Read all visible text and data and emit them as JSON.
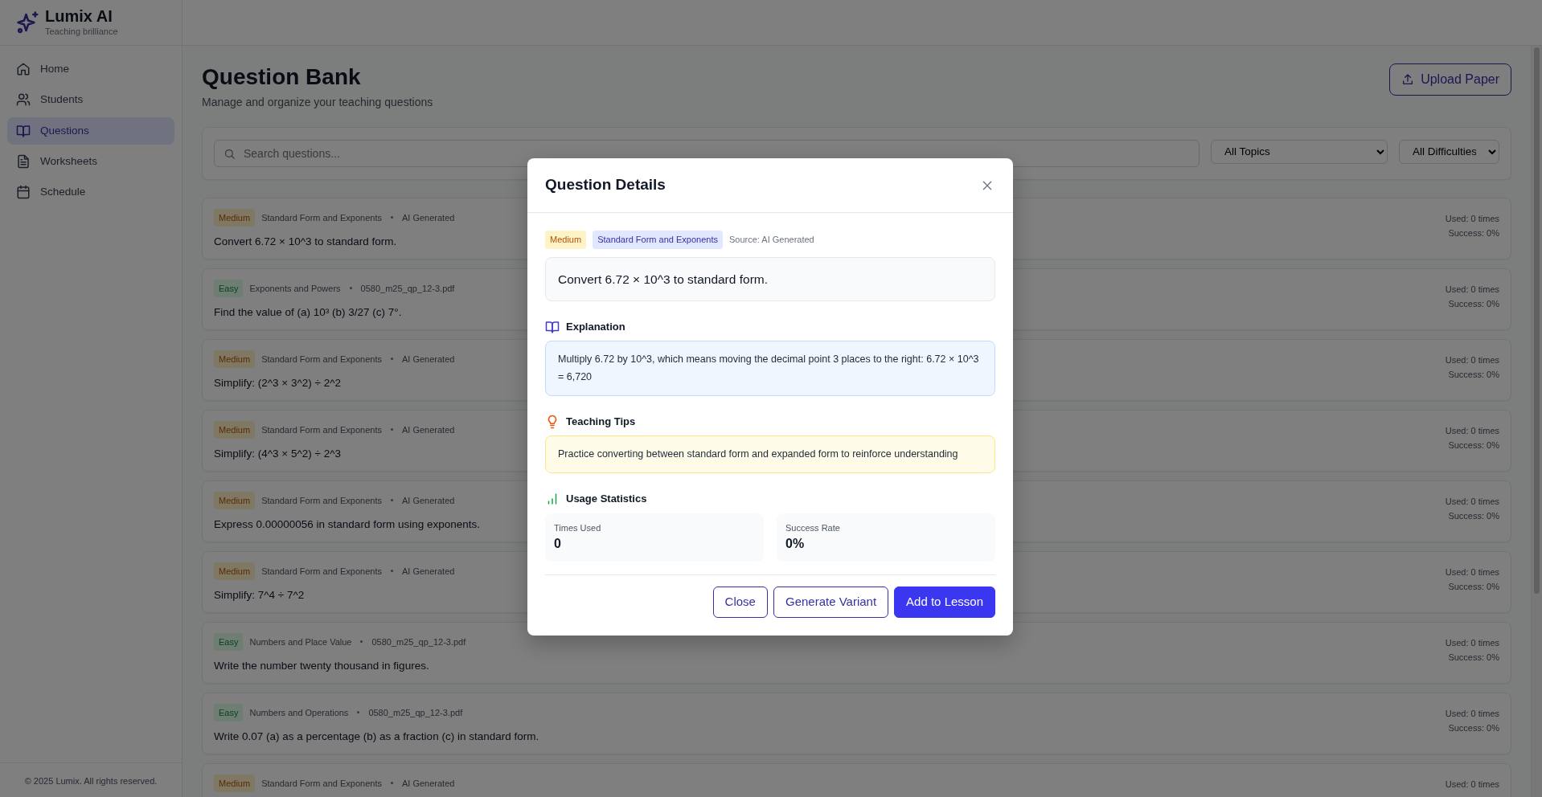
{
  "brand": {
    "name": "Lumix AI",
    "tagline": "Teaching brilliance"
  },
  "sidebar": {
    "items": [
      {
        "label": "Home",
        "selected": false
      },
      {
        "label": "Students",
        "selected": false
      },
      {
        "label": "Questions",
        "selected": true
      },
      {
        "label": "Worksheets",
        "selected": false
      },
      {
        "label": "Schedule",
        "selected": false
      }
    ],
    "footer": "© 2025 Lumix. All rights reserved."
  },
  "page": {
    "title": "Question Bank",
    "subtitle": "Manage and organize your teaching questions",
    "upload_button": "Upload Paper"
  },
  "filters": {
    "search": {
      "placeholder": "Search questions..."
    },
    "topic": "All Topics",
    "difficulty": "All Difficulties"
  },
  "questions": [
    {
      "difficulty": "Medium",
      "kind": "medium",
      "topic": "Standard Form and Exponents",
      "source": "AI Generated",
      "text": "Convert 6.72 × 10^3 to standard form.",
      "used": "Used: 0 times",
      "success": "Success: 0%"
    },
    {
      "difficulty": "Easy",
      "kind": "easy",
      "topic": "Exponents and Powers",
      "source": "0580_m25_qp_12-3.pdf",
      "text": "Find the value of (a) 10³ (b) 3/27 (c) 7°.",
      "used": "Used: 0 times",
      "success": "Success: 0%"
    },
    {
      "difficulty": "Medium",
      "kind": "medium",
      "topic": "Standard Form and Exponents",
      "source": "AI Generated",
      "text": "Simplify: (2^3 × 3^2) ÷ 2^2",
      "used": "Used: 0 times",
      "success": "Success: 0%"
    },
    {
      "difficulty": "Medium",
      "kind": "medium",
      "topic": "Standard Form and Exponents",
      "source": "AI Generated",
      "text": "Simplify: (4^3 × 5^2) ÷ 2^3",
      "used": "Used: 0 times",
      "success": "Success: 0%"
    },
    {
      "difficulty": "Medium",
      "kind": "medium",
      "topic": "Standard Form and Exponents",
      "source": "AI Generated",
      "text": "Express 0.00000056 in standard form using exponents.",
      "used": "Used: 0 times",
      "success": "Success: 0%"
    },
    {
      "difficulty": "Medium",
      "kind": "medium",
      "topic": "Standard Form and Exponents",
      "source": "AI Generated",
      "text": "Simplify: 7^4 ÷ 7^2",
      "used": "Used: 0 times",
      "success": "Success: 0%"
    },
    {
      "difficulty": "Easy",
      "kind": "easy",
      "topic": "Numbers and Place Value",
      "source": "0580_m25_qp_12-3.pdf",
      "text": "Write the number twenty thousand in figures.",
      "used": "Used: 0 times",
      "success": "Success: 0%"
    },
    {
      "difficulty": "Easy",
      "kind": "easy",
      "topic": "Numbers and Operations",
      "source": "0580_m25_qp_12-3.pdf",
      "text": "Write 0.07 (a) as a percentage (b) as a fraction (c) in standard form.",
      "used": "Used: 0 times",
      "success": "Success: 0%"
    },
    {
      "difficulty": "Medium",
      "kind": "medium",
      "topic": "Standard Form and Exponents",
      "source": "AI Generated",
      "used": "Used: 0 times"
    }
  ],
  "modal": {
    "title": "Question Details",
    "difficulty": "Medium",
    "kind": "medium",
    "topic": "Standard Form and Exponents",
    "source": "Source: AI Generated",
    "question": "Convert 6.72 × 10^3 to standard form.",
    "explanation_heading": "Explanation",
    "explanation": "Multiply 6.72 by 10^3, which means moving the decimal point 3 places to the right: 6.72 × 10^3 = 6,720",
    "tips_heading": "Teaching Tips",
    "tips": "Practice converting between standard form and expanded form to reinforce understanding",
    "stats_heading": "Usage Statistics",
    "stats": [
      {
        "label": "Times Used",
        "value": "0"
      },
      {
        "label": "Success Rate",
        "value": "0%"
      }
    ],
    "buttons": [
      {
        "label": "Close",
        "kind": "outline"
      },
      {
        "label": "Generate Variant",
        "kind": "outline"
      },
      {
        "label": "Add to Lesson",
        "kind": "primary"
      }
    ]
  }
}
